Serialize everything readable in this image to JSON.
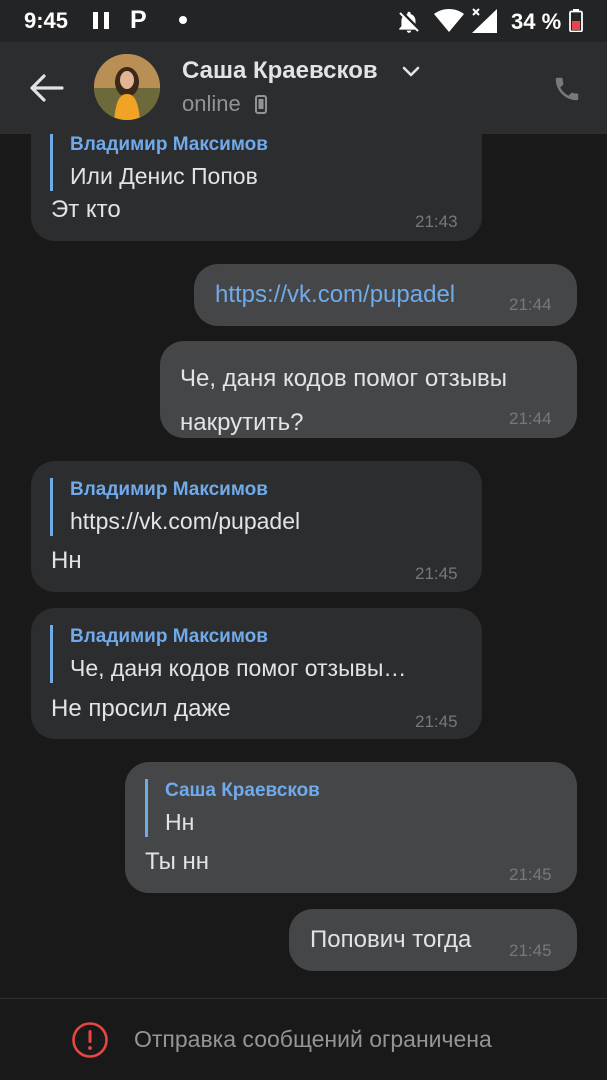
{
  "status_bar": {
    "time": "9:45",
    "p_icon": "P",
    "battery": "34 %"
  },
  "header": {
    "name": "Саша Краевсков",
    "status": "online"
  },
  "messages": [
    {
      "reply_author": "Владимир Максимов",
      "reply_text": "Или Денис Попов",
      "text": "Эт кто",
      "time": "21:43"
    },
    {
      "text": "https://vk.com/pupadel",
      "time": "21:44"
    },
    {
      "text": "Че, даня кодов помог отзывы накрутить?",
      "time": "21:44"
    },
    {
      "reply_author": "Владимир Максимов",
      "reply_text": "https://vk.com/pupadel",
      "text": "Нн",
      "time": "21:45"
    },
    {
      "reply_author": "Владимир Максимов",
      "reply_text": "Че, даня кодов помог отзывы…",
      "text": "Не просил даже",
      "time": "21:45"
    },
    {
      "reply_author": "Саша Краевсков",
      "reply_text": "Нн",
      "text": "Ты нн",
      "time": "21:45"
    },
    {
      "text": "Попович тогда",
      "time": "21:45"
    }
  ],
  "footer": {
    "text": "Отправка сообщений ограничена"
  },
  "colors": {
    "link": "#71aaeb",
    "warning": "#e64646"
  },
  "icons": [
    "pause-icon",
    "notifications-off-icon",
    "wifi-icon",
    "signal-icon",
    "battery-icon",
    "back-arrow-icon",
    "chevron-down-icon",
    "mobile-phone-icon",
    "call-icon",
    "warning-icon"
  ]
}
